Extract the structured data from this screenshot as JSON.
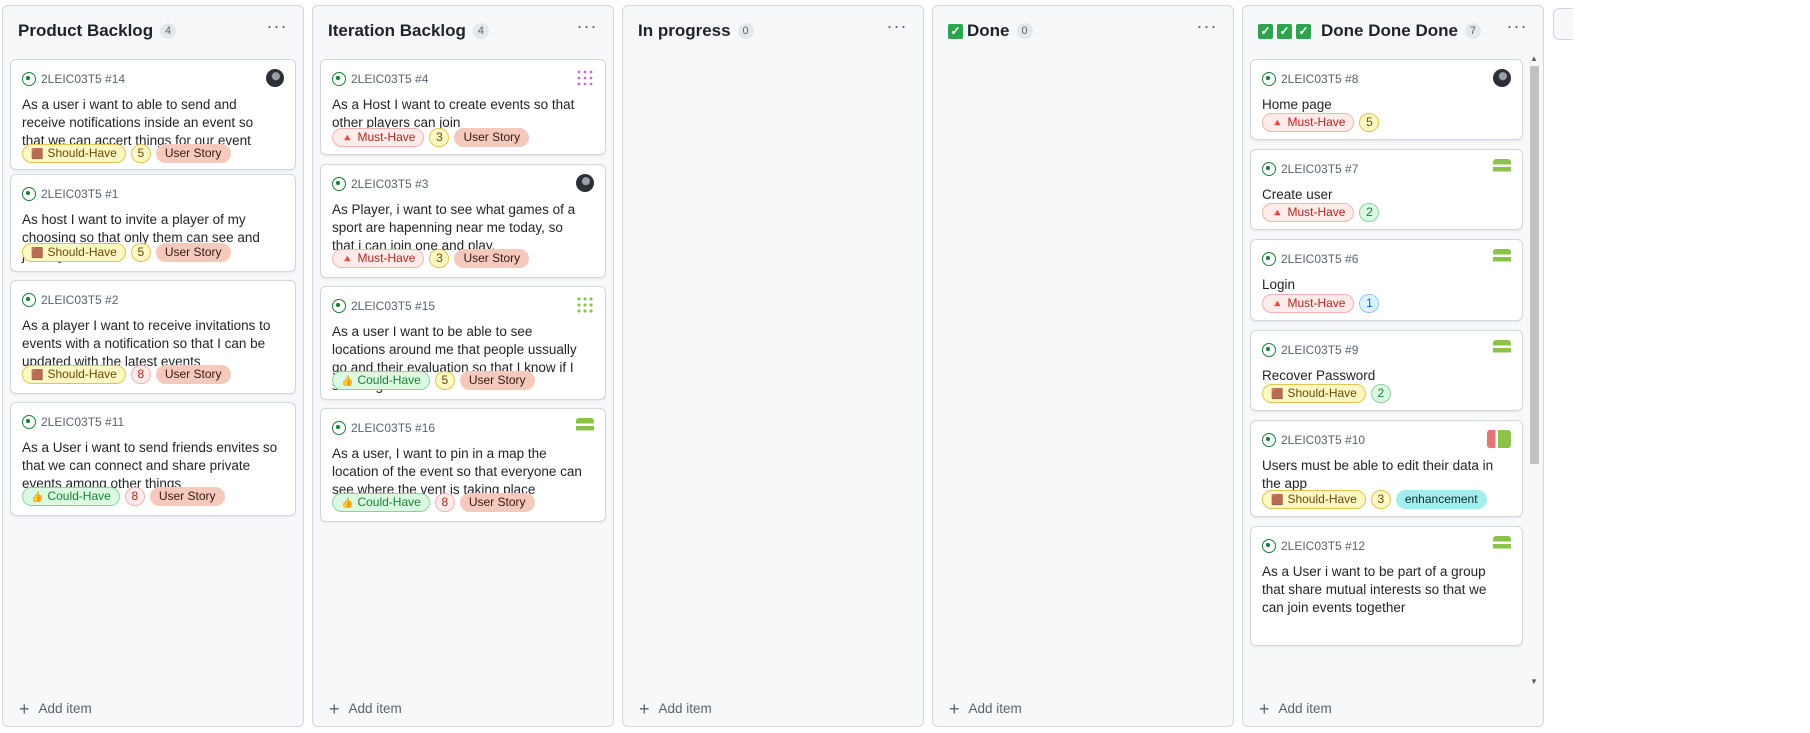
{
  "columns": [
    {
      "title": "Product Backlog",
      "count": "4",
      "add_label": "Add item",
      "cards": [
        {
          "ref": "2LEIC03T5 #14",
          "title": "As a user i want to able to send and receive notifications inside an event so that we can accert things for our event",
          "priority": "Should-Have",
          "points": "5",
          "type": "User Story",
          "avatar": "dark"
        },
        {
          "ref": "2LEIC03T5 #1",
          "title": "As host I want to invite a player of my choosing so that only them can see and join my event",
          "priority": "Should-Have",
          "points": "5",
          "type": "User Story"
        },
        {
          "ref": "2LEIC03T5 #2",
          "title": "As a player I want to receive invitations to events with a notification so that I can be updated with the latest events",
          "priority": "Should-Have",
          "points": "8",
          "type": "User Story"
        },
        {
          "ref": "2LEIC03T5 #11",
          "title": "As a User i want to send friends envites so that we can connect and share private events among other things",
          "priority": "Could-Have",
          "points": "8",
          "type": "User Story"
        }
      ]
    },
    {
      "title": "Iteration Backlog",
      "count": "4",
      "add_label": "Add item",
      "cards": [
        {
          "ref": "2LEIC03T5 #4",
          "title": "As a Host I want to create events so that other players can join",
          "priority": "Must-Have",
          "points": "3",
          "type": "User Story",
          "avatar": "purple"
        },
        {
          "ref": "2LEIC03T5 #3",
          "title": "As Player, i want to see what games of a sport are hapenning near me today, so that i can join one and play.",
          "priority": "Must-Have",
          "points": "3",
          "type": "User Story",
          "avatar": "dark"
        },
        {
          "ref": "2LEIC03T5 #15",
          "title": "As a user I want to be able to see locations around me that people ussually go and their evaluation so that I know if I should go there",
          "priority": "Could-Have",
          "points": "5",
          "type": "User Story",
          "avatar": "green"
        },
        {
          "ref": "2LEIC03T5 #16",
          "title": "As a user, I want to pin in a map the location of the event so that everyone can see where the vent is taking place",
          "priority": "Could-Have",
          "points": "8",
          "type": "User Story",
          "avatar": "lime"
        }
      ]
    },
    {
      "title": "In progress",
      "count": "0",
      "add_label": "Add item",
      "cards": []
    },
    {
      "title": "Done",
      "count": "0",
      "add_label": "Add item",
      "cards": []
    },
    {
      "title": "Done Done Done",
      "count": "7",
      "add_label": "Add item",
      "cards": [
        {
          "ref": "2LEIC03T5 #8",
          "title": "Home page",
          "priority": "Must-Have",
          "points": "5",
          "avatar": "dark"
        },
        {
          "ref": "2LEIC03T5 #7",
          "title": "Create user",
          "priority": "Must-Have",
          "points": "2",
          "avatar": "lime"
        },
        {
          "ref": "2LEIC03T5 #6",
          "title": "Login",
          "priority": "Must-Have",
          "points": "1",
          "avatar": "lime"
        },
        {
          "ref": "2LEIC03T5 #9",
          "title": "Recover Password",
          "priority": "Should-Have",
          "points": "2",
          "avatar": "lime"
        },
        {
          "ref": "2LEIC03T5 #10",
          "title": "Users must be able to edit their data in the app",
          "priority": "Should-Have",
          "points": "3",
          "type": "enhancement",
          "avatar": "pair"
        },
        {
          "ref": "2LEIC03T5 #12",
          "title": "As a User i want to be part of a group that share mutual interests so that we can join events together",
          "avatar": "lime"
        }
      ]
    }
  ],
  "icons": {
    "menu": "ellipsis-icon",
    "issue": "issue-open-icon",
    "add": "plus-icon",
    "check": "checkbox-checked-icon"
  },
  "colors": {
    "open_issue": "#1a7f37",
    "must": "#b3261e",
    "should": "#6b4a00",
    "could": "#1a7f37",
    "user_story": "#f6c9bd",
    "enhancement": "#a2eeef"
  }
}
